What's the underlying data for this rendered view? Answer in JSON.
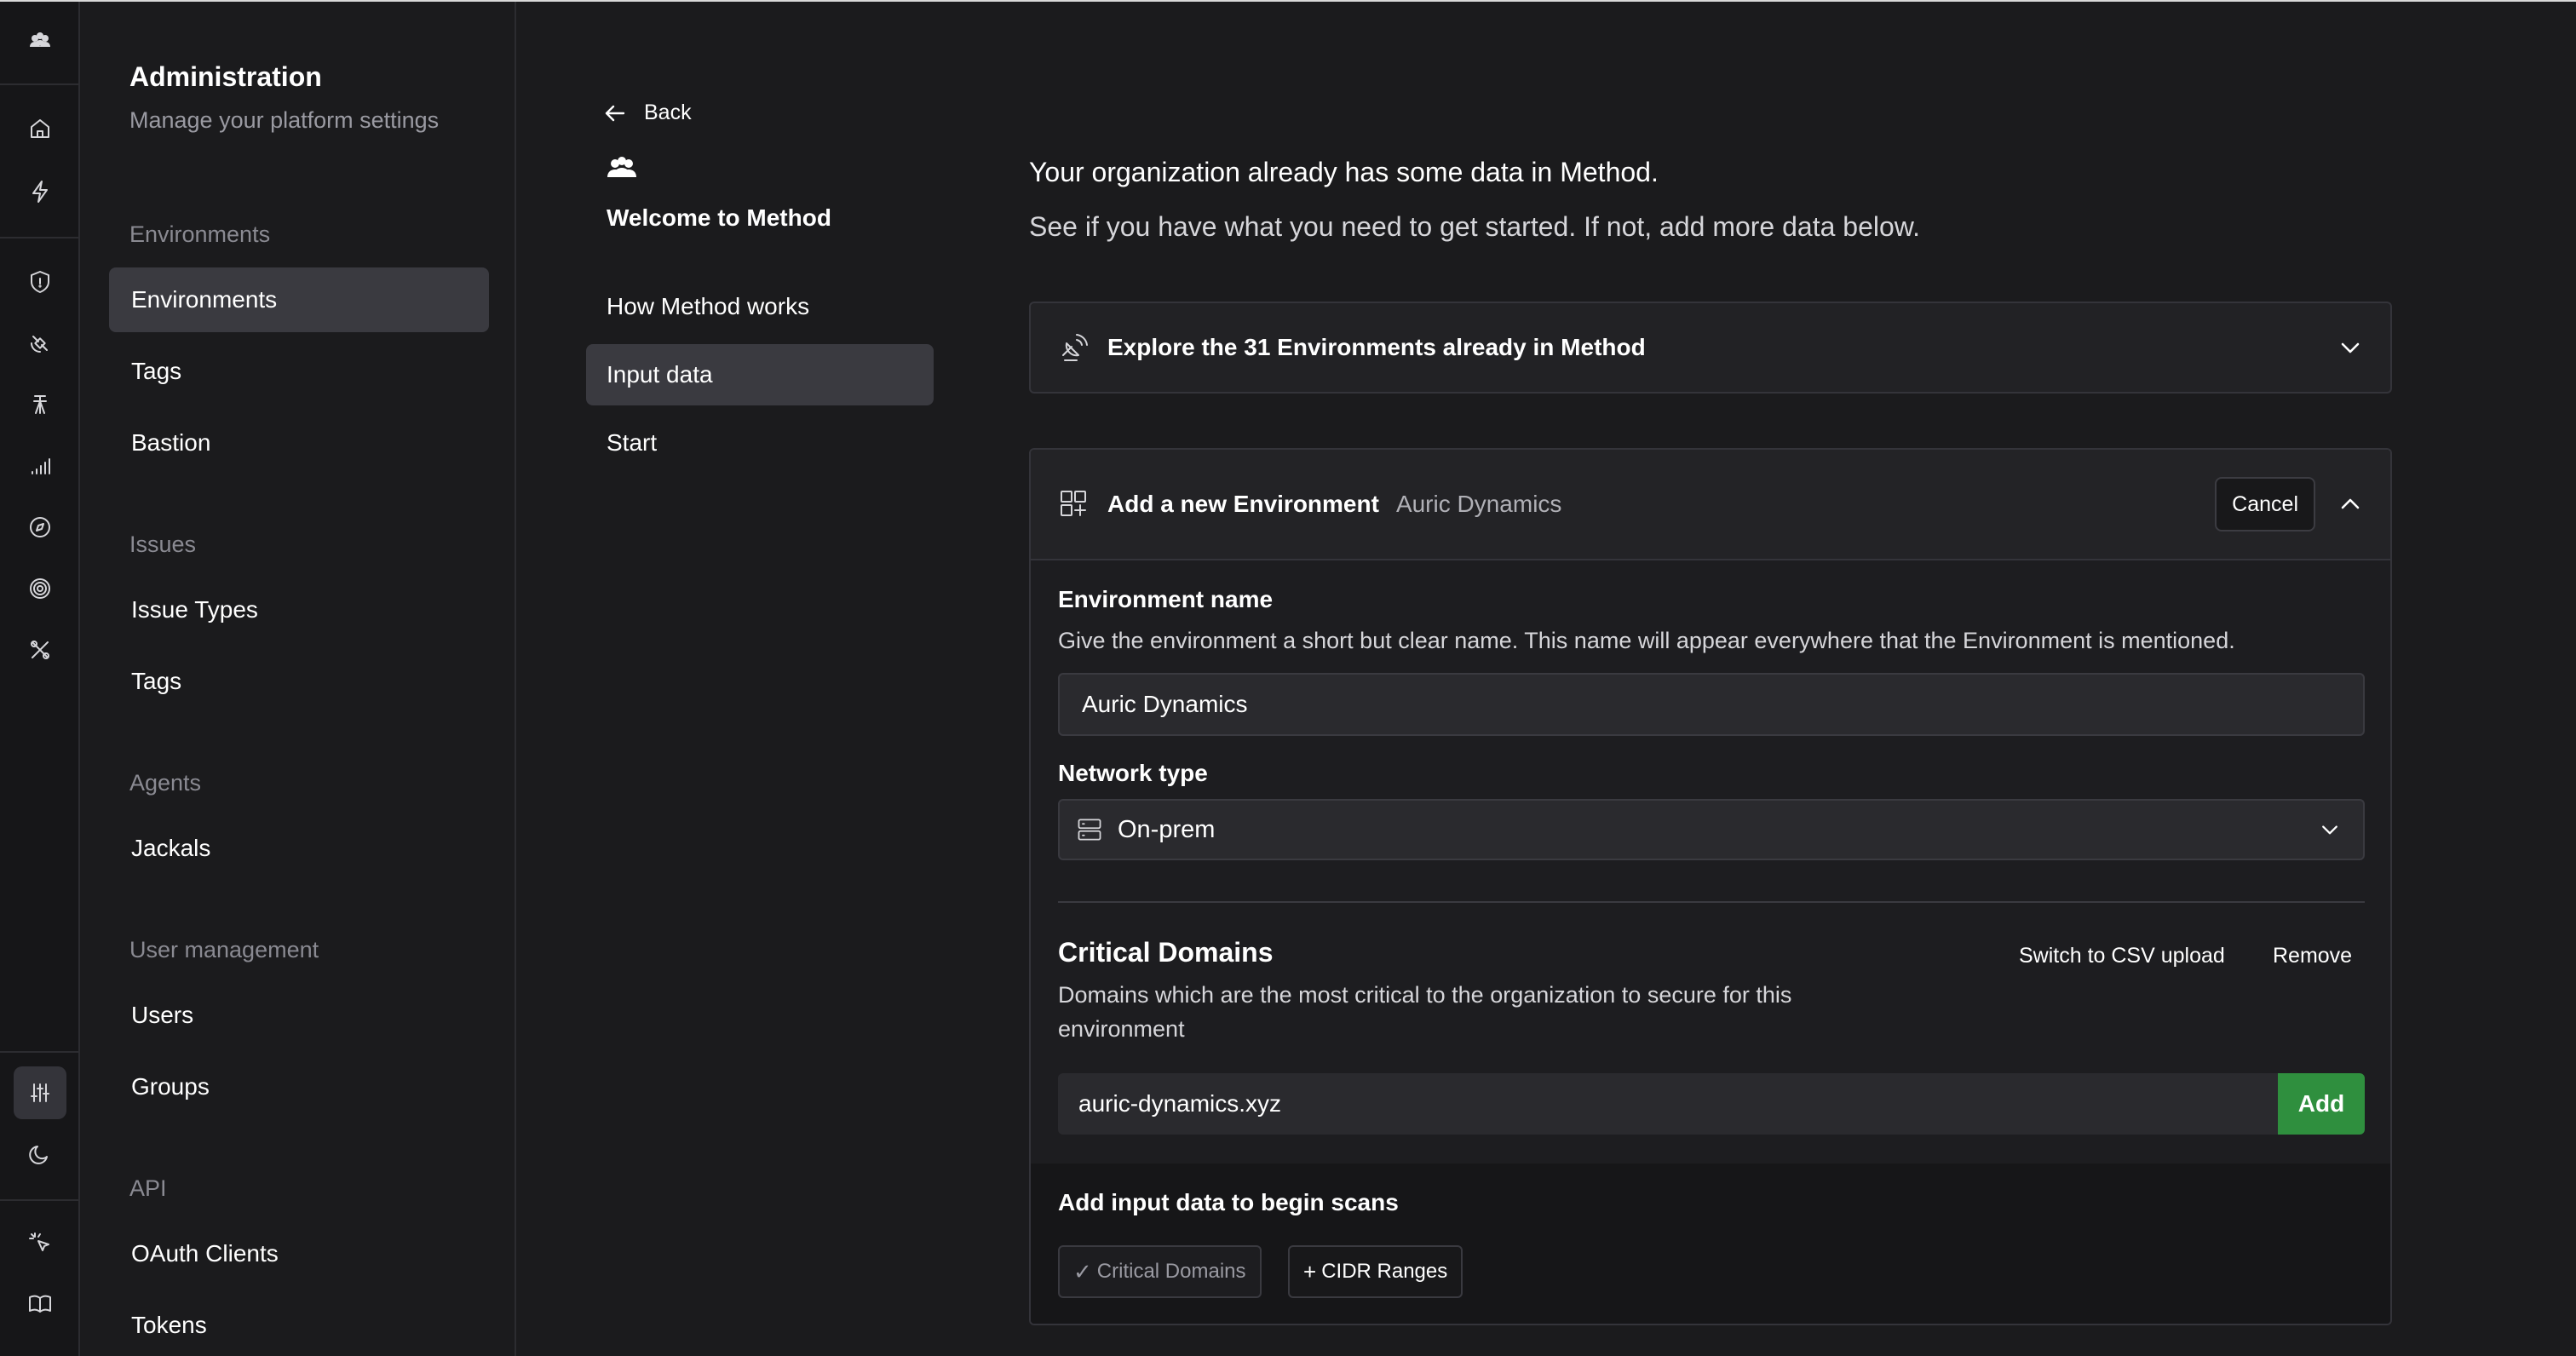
{
  "sidebar": {
    "title": "Administration",
    "subtitle": "Manage your platform settings",
    "groups": {
      "environments": "Environments",
      "issues": "Issues",
      "agents": "Agents",
      "user_management": "User management",
      "api": "API"
    },
    "items": {
      "environments": "Environments",
      "env_tags": "Tags",
      "bastion": "Bastion",
      "issue_types": "Issue Types",
      "issue_tags": "Tags",
      "jackals": "Jackals",
      "users": "Users",
      "groups": "Groups",
      "oauth_clients": "OAuth Clients",
      "tokens": "Tokens"
    }
  },
  "wizard": {
    "back": "Back",
    "title": "Welcome to Method",
    "steps": [
      "How Method works",
      "Input data",
      "Start"
    ],
    "active_step": 1
  },
  "main": {
    "intro_line1": "Your organization already has some data in Method.",
    "intro_line2": "See if you have what you need to get started. If not, add more data below.",
    "explore_label": "Explore the 31 Environments already in Method",
    "card": {
      "title": "Add a new Environment",
      "subtitle": "Auric Dynamics",
      "cancel": "Cancel",
      "env_name_label": "Environment name",
      "env_name_help": "Give the environment a short but clear name. This name will appear everywhere that the Environment is mentioned.",
      "env_name_value": "Auric Dynamics",
      "network_type_label": "Network type",
      "network_type_value": "On-prem",
      "critical_title": "Critical Domains",
      "switch_csv": "Switch to CSV upload",
      "remove": "Remove",
      "critical_help_1": "Domains which are the most critical to the organization to secure for this",
      "critical_help_2": "environment",
      "domain_value": "auric-dynamics.xyz",
      "add": "Add",
      "footer_title": "Add input data to begin scans",
      "chip_done": "Critical Domains",
      "chip_add": "CIDR Ranges"
    }
  }
}
